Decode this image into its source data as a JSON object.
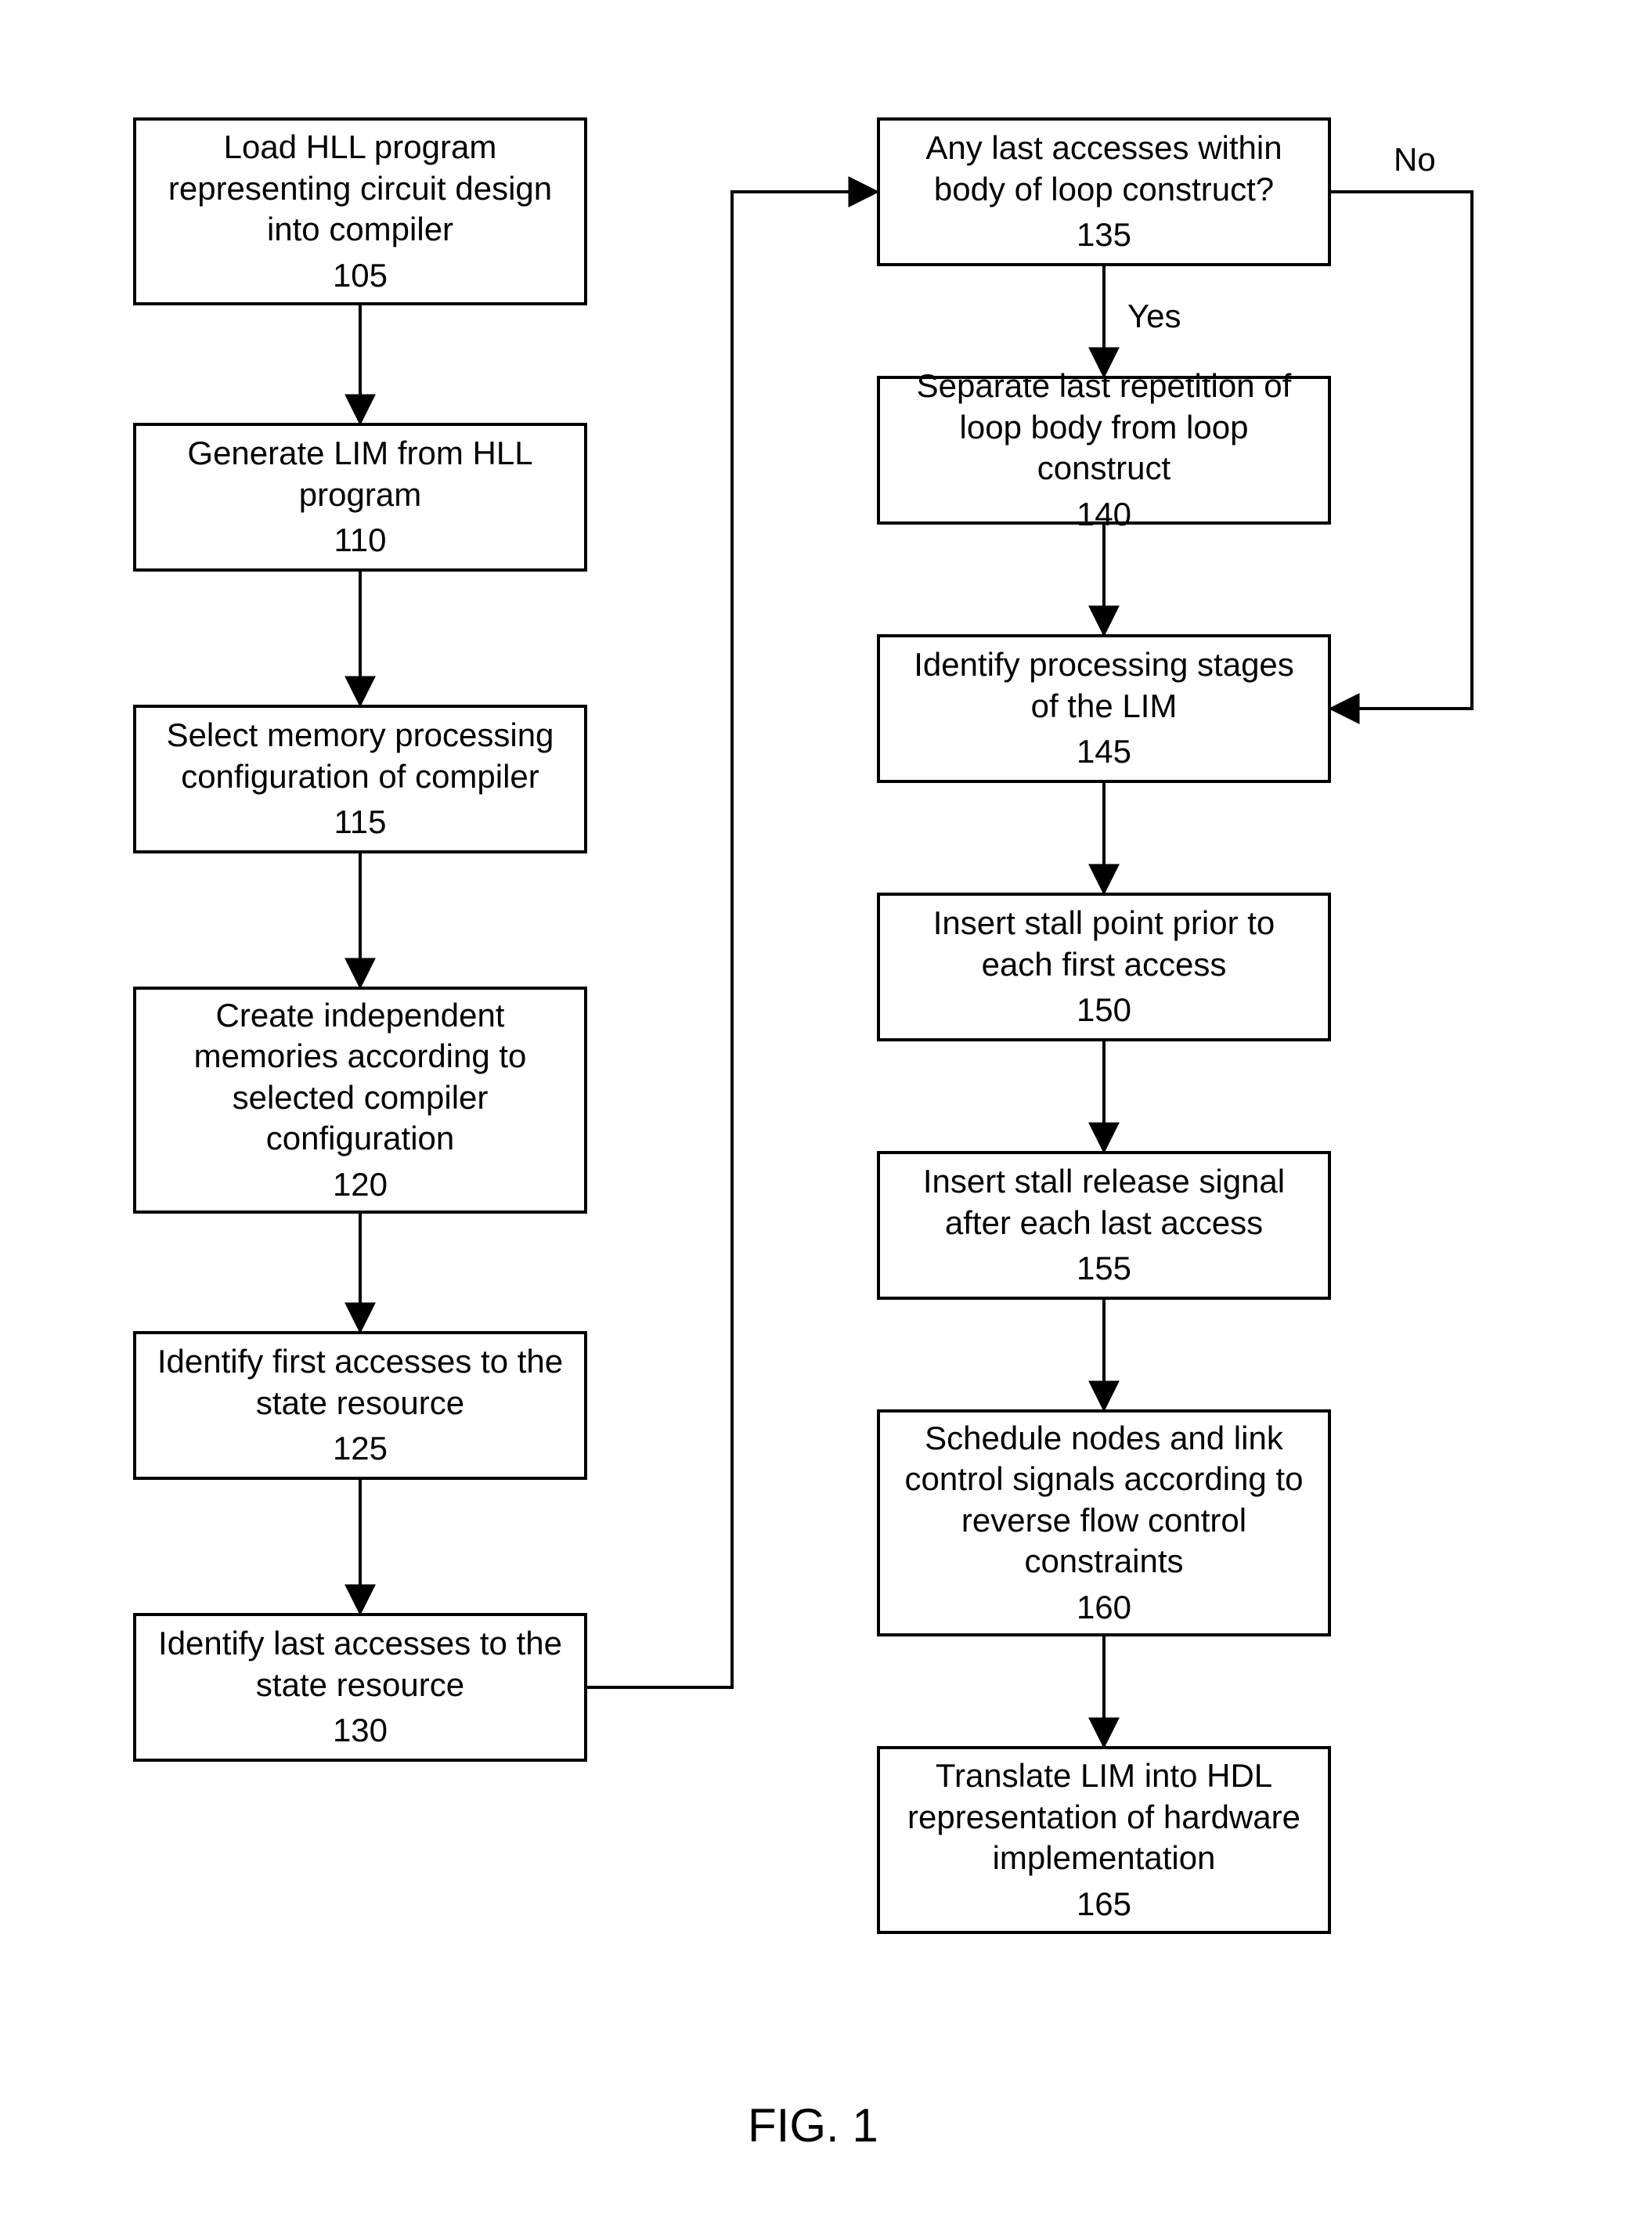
{
  "figure_label": "FIG. 1",
  "edge_labels": {
    "yes": "Yes",
    "no": "No"
  },
  "nodes": {
    "n105": {
      "text": "Load HLL program representing circuit design into compiler",
      "num": "105"
    },
    "n110": {
      "text": "Generate LIM from HLL program",
      "num": "110"
    },
    "n115": {
      "text": "Select memory processing configuration of compiler",
      "num": "115"
    },
    "n120": {
      "text": "Create independent memories according to selected compiler configuration",
      "num": "120"
    },
    "n125": {
      "text": "Identify first accesses to the state resource",
      "num": "125"
    },
    "n130": {
      "text": "Identify last accesses to the state resource",
      "num": "130"
    },
    "n135": {
      "text": "Any last accesses within body of loop construct?",
      "num": "135"
    },
    "n140": {
      "text": "Separate last repetition of loop body from loop construct",
      "num": "140"
    },
    "n145": {
      "text": "Identify processing stages of the LIM",
      "num": "145"
    },
    "n150": {
      "text": "Insert stall point prior to each first access",
      "num": "150"
    },
    "n155": {
      "text": "Insert stall release signal after each last access",
      "num": "155"
    },
    "n160": {
      "text": "Schedule nodes and link control signals according to reverse flow control constraints",
      "num": "160"
    },
    "n165": {
      "text": "Translate LIM into HDL representation of hardware implementation",
      "num": "165"
    }
  }
}
